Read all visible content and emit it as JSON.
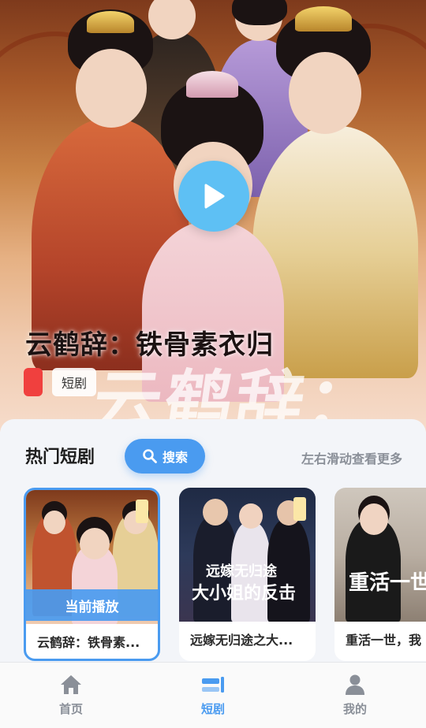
{
  "hero": {
    "title": "云鹤辞：铁骨素衣归",
    "tag": "短剧",
    "calligraphy": "云鹤辞：",
    "colors": {
      "play_button": "#5ec0f4",
      "tag_red": "#f0403e"
    }
  },
  "section": {
    "title": "热门短剧",
    "search_label": "搜索",
    "swipe_hint": "左右滑动查看更多"
  },
  "cards": [
    {
      "title": "云鹤辞：铁骨素...",
      "status": "当前播放",
      "active": true
    },
    {
      "title": "远嫁无归途之大...",
      "poster_text_1": "远嫁无归途",
      "poster_text_2": "大小姐的反击",
      "active": false
    },
    {
      "title": "重活一世，我",
      "poster_text_1": "重活一世",
      "active": false
    }
  ],
  "nav": {
    "items": [
      {
        "label": "首页",
        "icon": "home-icon",
        "active": false
      },
      {
        "label": "短剧",
        "icon": "short-drama-icon",
        "active": true
      },
      {
        "label": "我的",
        "icon": "user-icon",
        "active": false
      }
    ],
    "active_color": "#4a9bf0"
  }
}
